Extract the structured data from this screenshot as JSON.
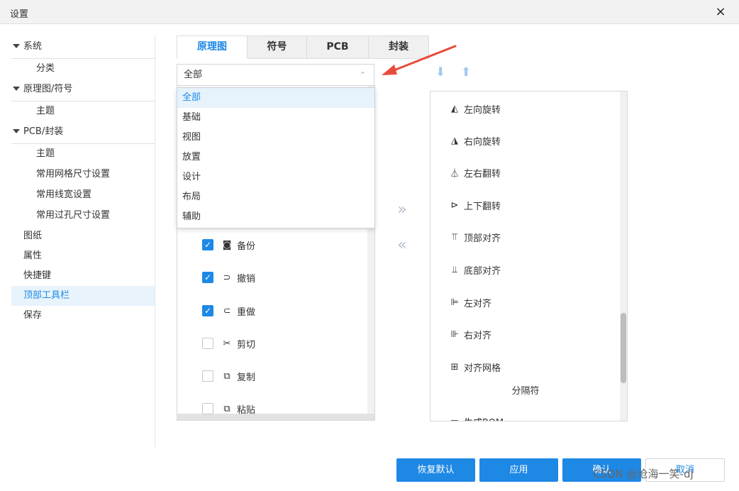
{
  "window": {
    "title": "设置",
    "close_glyph": "×"
  },
  "sidebar": {
    "groups": [
      {
        "label": "系统",
        "children": [
          "分类"
        ]
      },
      {
        "label": "原理图/符号",
        "children": [
          "主题"
        ]
      },
      {
        "label": "PCB/封装",
        "children": [
          "主题",
          "常用网格尺寸设置",
          "常用线宽设置",
          "常用过孔尺寸设置"
        ]
      }
    ],
    "leaves": [
      "图纸",
      "属性",
      "快捷键",
      "顶部工具栏",
      "保存"
    ],
    "active": "顶部工具栏"
  },
  "tabs": [
    {
      "label": "原理图",
      "active": true
    },
    {
      "label": "符号",
      "active": false
    },
    {
      "label": "PCB",
      "active": false
    },
    {
      "label": "封装",
      "active": false
    }
  ],
  "category_select": {
    "value": "全部",
    "chevron": "⌃",
    "options": [
      "全部",
      "基础",
      "视图",
      "放置",
      "设计",
      "布局",
      "辅助"
    ],
    "selected": "全部"
  },
  "left_list": [
    {
      "label": "备份",
      "icon": "backup-icon",
      "glyph": "◙",
      "checked": true
    },
    {
      "label": "撤销",
      "icon": "undo-icon",
      "glyph": "⊃",
      "checked": true
    },
    {
      "label": "重做",
      "icon": "redo-icon",
      "glyph": "⊂",
      "checked": true
    },
    {
      "label": "剪切",
      "icon": "scissors-icon",
      "glyph": "✂",
      "checked": false
    },
    {
      "label": "复制",
      "icon": "copy-icon",
      "glyph": "⧉",
      "checked": false
    },
    {
      "label": "粘贴",
      "icon": "paste-icon",
      "glyph": "⧉",
      "checked": false
    }
  ],
  "transfer": {
    "add": "»",
    "remove": "«"
  },
  "move": {
    "down": "⬇",
    "up": "⬆"
  },
  "right_list": [
    {
      "label": "左向旋转",
      "icon": "rotate-left-icon",
      "glyph": "◭"
    },
    {
      "label": "右向旋转",
      "icon": "rotate-right-icon",
      "glyph": "◮"
    },
    {
      "label": "左右翻转",
      "icon": "flip-horizontal-icon",
      "glyph": "⏃"
    },
    {
      "label": "上下翻转",
      "icon": "flip-vertical-icon",
      "glyph": "⊳"
    },
    {
      "label": "顶部对齐",
      "icon": "align-top-icon",
      "glyph": "⫪"
    },
    {
      "label": "底部对齐",
      "icon": "align-bottom-icon",
      "glyph": "⫫"
    },
    {
      "label": "左对齐",
      "icon": "align-left-icon",
      "glyph": "⊫"
    },
    {
      "label": "右对齐",
      "icon": "align-right-icon",
      "glyph": "⊪"
    },
    {
      "label": "对齐网格",
      "icon": "align-grid-icon",
      "glyph": "⊞"
    }
  ],
  "separator_label": "分隔符",
  "cut_off_item": {
    "label": "生成BOM",
    "glyph": "▭"
  },
  "buttons": {
    "restore": "恢复默认",
    "apply": "应用",
    "confirm": "确认",
    "cancel": "取消"
  },
  "watermark": "CSDN @沧海一笑-dj",
  "colors": {
    "accent": "#1e88e5",
    "annotation_arrow": "#e74c3c"
  }
}
